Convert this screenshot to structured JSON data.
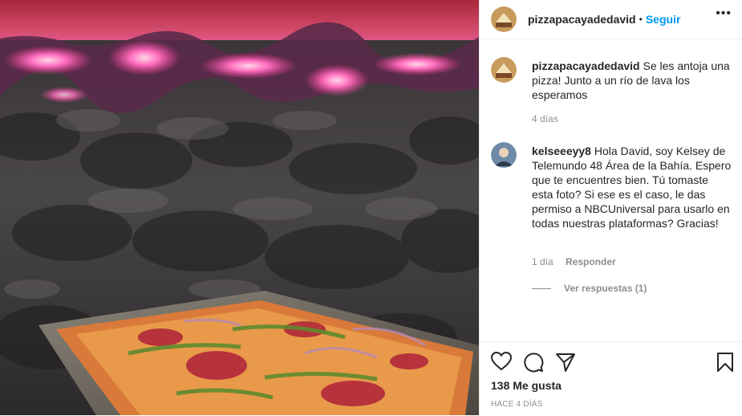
{
  "post": {
    "username": "pizzapacayadedavid",
    "follow_label": "Seguir",
    "separator": "•",
    "more_label": "•••",
    "image_alt": "Pizza sobre lava volcánica"
  },
  "caption": {
    "username": "pizzapacayadedavid",
    "text": "Se les antoja una pizza! Junto a un río de lava los esperamos",
    "time": "4 días"
  },
  "comments": [
    {
      "username": "kelseeeyy8",
      "text": "Hola David, soy Kelsey de Telemundo 48 Área de la Bahía. Espero que te encuentres bien. Tú tomaste esta foto? Si ese es el caso, le das permiso a NBCUniversal para usarlo en todas nuestras plataformas? Gracias!",
      "time": "1 día",
      "reply_label": "Responder",
      "view_replies": "Ver respuestas (1)"
    }
  ],
  "actions": {
    "likes": "138 Me gusta",
    "timestamp": "HACE 4 DÍAS",
    "icons": [
      "heart-icon",
      "comment-icon",
      "share-icon",
      "bookmark-icon"
    ]
  },
  "colors": {
    "accent": "#0095f6",
    "secondary_text": "#8e8e8e",
    "border": "#efefef"
  }
}
